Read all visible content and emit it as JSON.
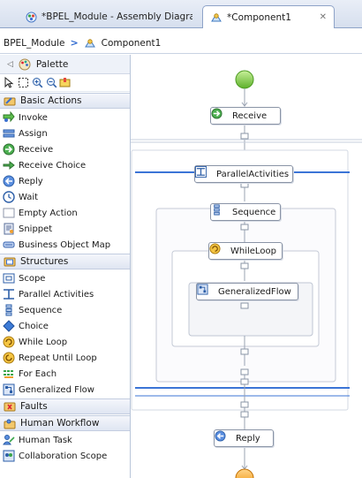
{
  "tabs": [
    {
      "label": "*BPEL_Module - Assembly Diagram",
      "icon": "assembly-diagram-icon",
      "active": false
    },
    {
      "label": "*Component1",
      "icon": "component-icon",
      "active": true,
      "close_icon": "close-icon"
    }
  ],
  "breadcrumb": {
    "module": "BPEL_Module",
    "separator": ">",
    "component": "Component1"
  },
  "palette": {
    "title": "Palette",
    "basic_actions": {
      "label": "Basic Actions",
      "items": [
        {
          "label": "Invoke",
          "icon": "invoke-icon"
        },
        {
          "label": "Assign",
          "icon": "assign-icon"
        },
        {
          "label": "Receive",
          "icon": "receive-icon"
        },
        {
          "label": "Receive Choice",
          "icon": "receive-choice-icon"
        },
        {
          "label": "Reply",
          "icon": "reply-icon"
        },
        {
          "label": "Wait",
          "icon": "wait-icon"
        },
        {
          "label": "Empty Action",
          "icon": "empty-action-icon"
        },
        {
          "label": "Snippet",
          "icon": "snippet-icon"
        },
        {
          "label": "Business Object Map",
          "icon": "business-object-map-icon"
        }
      ]
    },
    "structures": {
      "label": "Structures",
      "items": [
        {
          "label": "Scope",
          "icon": "scope-icon"
        },
        {
          "label": "Parallel Activities",
          "icon": "parallel-activities-icon"
        },
        {
          "label": "Sequence",
          "icon": "sequence-icon"
        },
        {
          "label": "Choice",
          "icon": "choice-icon"
        },
        {
          "label": "While Loop",
          "icon": "while-loop-icon"
        },
        {
          "label": "Repeat Until Loop",
          "icon": "repeat-until-loop-icon"
        },
        {
          "label": "For Each",
          "icon": "for-each-icon"
        },
        {
          "label": "Generalized Flow",
          "icon": "generalized-flow-icon"
        }
      ]
    },
    "faults": {
      "label": "Faults"
    },
    "human_workflow": {
      "label": "Human Workflow",
      "items": [
        {
          "label": "Human Task",
          "icon": "human-task-icon"
        },
        {
          "label": "Collaboration Scope",
          "icon": "collaboration-scope-icon"
        }
      ]
    }
  },
  "diagram": {
    "receive": "Receive",
    "parallel": "ParallelActivities",
    "sequence": "Sequence",
    "whileloop": "WhileLoop",
    "generalized": "GeneralizedFlow",
    "reply": "Reply"
  },
  "colors": {
    "accent": "#2f6ad0",
    "start": "#7fd14a",
    "end": "#f5a623",
    "connector": "#9aa3b2"
  }
}
